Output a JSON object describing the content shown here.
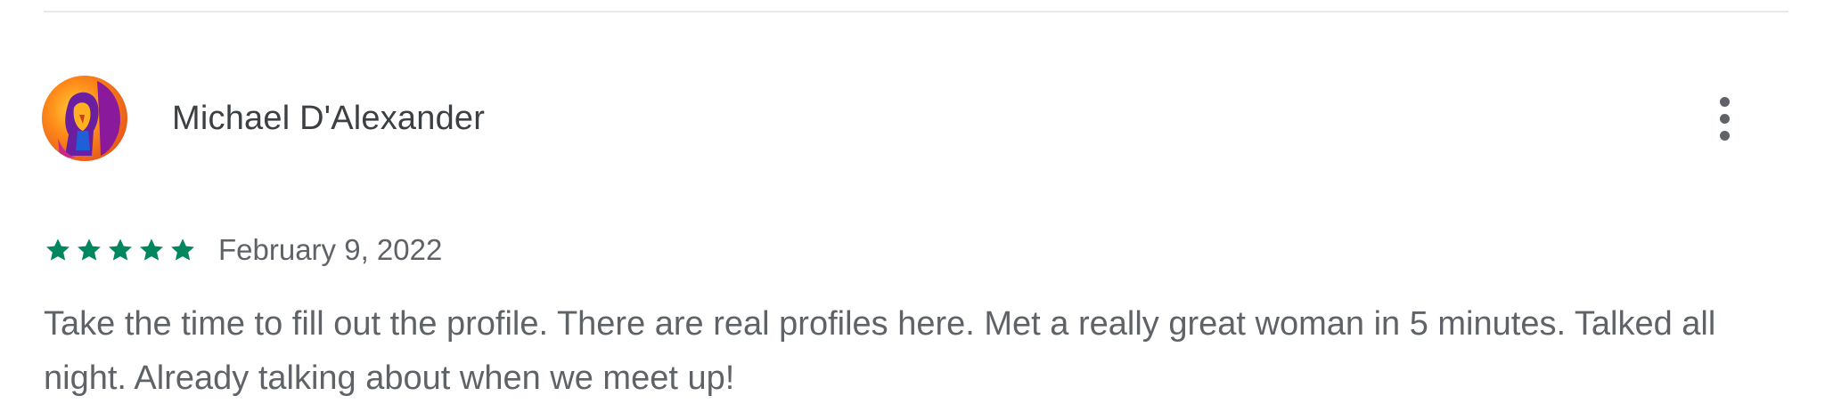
{
  "review": {
    "author_name": "Michael D'Alexander",
    "avatar_icon": "user-avatar-photo",
    "menu_icon": "more-vert-icon",
    "rating": 5,
    "rating_max": 5,
    "date": "February 9, 2022",
    "text": "Take the time to fill out the profile. There are real profiles here. Met a really great woman in 5 minutes. Talked all night. Already talking about when we meet up!"
  },
  "colors": {
    "star": "#01875f",
    "author_text": "#3c4043",
    "body_text": "#5f6368",
    "divider": "#e8eaed"
  }
}
